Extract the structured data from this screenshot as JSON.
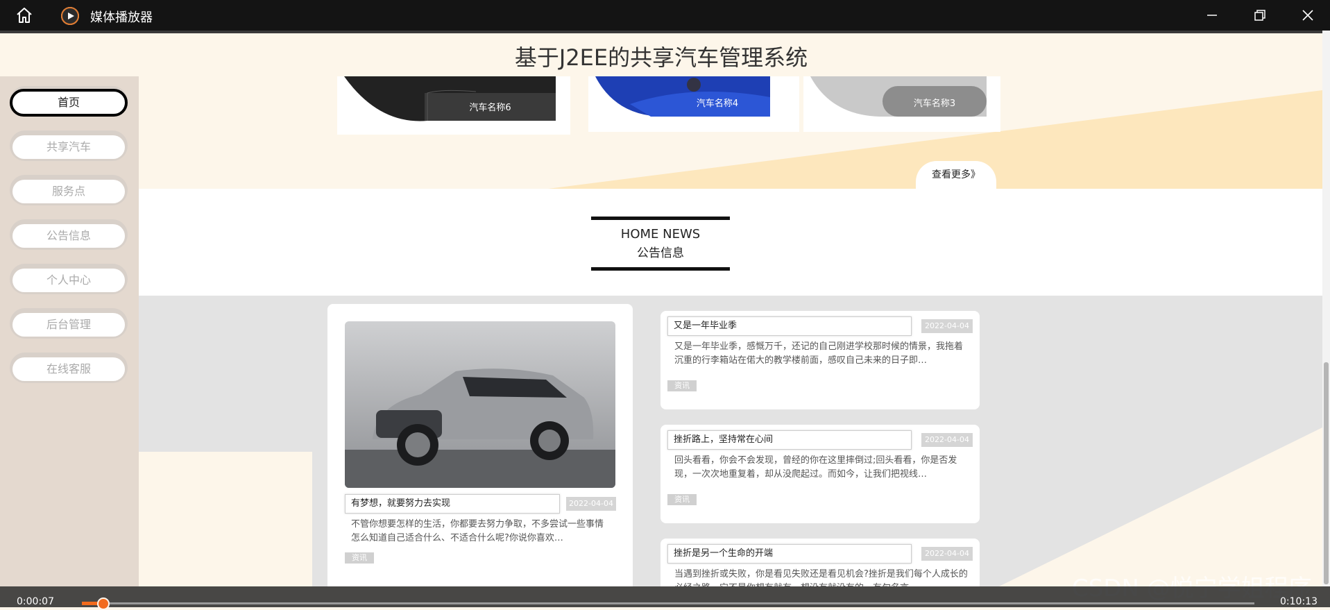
{
  "window": {
    "app_name": "媒体播放器",
    "icons": {
      "home": "home-icon",
      "app_logo": "media-player-logo-icon",
      "minimize": "minimize-icon",
      "restore": "restore-icon",
      "close": "close-icon"
    }
  },
  "site": {
    "title": "基于J2EE的共享汽车管理系统"
  },
  "sidebar": {
    "items": [
      {
        "label": "首页",
        "active": true
      },
      {
        "label": "共享汽车",
        "active": false
      },
      {
        "label": "服务点",
        "active": false
      },
      {
        "label": "公告信息",
        "active": false
      },
      {
        "label": "个人中心",
        "active": false
      },
      {
        "label": "后台管理",
        "active": false
      },
      {
        "label": "在线客服",
        "active": false
      }
    ]
  },
  "cars": [
    {
      "name": "汽车名称6"
    },
    {
      "name": "汽车名称4"
    },
    {
      "name": "汽车名称3"
    }
  ],
  "view_more": "查看更多》",
  "news_section": {
    "title_en": "HOME NEWS",
    "title_cn": "公告信息"
  },
  "featured_news": {
    "title": "有梦想，就要努力去实现",
    "date": "2022-04-04",
    "excerpt": "不管你想要怎样的生活，你都要去努力争取，不多尝试一些事情怎么知道自己适合什么、不适合什么呢?你说你喜欢…",
    "tag": "资讯"
  },
  "news_list": [
    {
      "title": "又是一年毕业季",
      "date": "2022-04-04",
      "excerpt": "又是一年毕业季，感慨万千，还记的自己刚进学校那时候的情景，我拖着沉重的行李箱站在偌大的教学楼前面，感叹自己未来的日子即…",
      "tag": "资讯"
    },
    {
      "title": "挫折路上，坚持常在心间",
      "date": "2022-04-04",
      "excerpt": "回头看看，你会不会发现，曾经的你在这里摔倒过;回头看看，你是否发现，一次次地重复着，却从没爬起过。而如今，让我们把视线…",
      "tag": "资讯"
    },
    {
      "title": "挫折是另一个生命的开端",
      "date": "2022-04-04",
      "excerpt": "当遇到挫折或失败，你是看见失败还是看见机会?挫折是我们每个人成长的必经之路，它不是你想有就有，想没有就没有的。有句名言…",
      "tag": ""
    }
  ],
  "player": {
    "current_time": "0:00:07",
    "total_time": "0:10:13",
    "progress": 0.011
  },
  "watermark": "CSDN @悦宁学姐程序"
}
